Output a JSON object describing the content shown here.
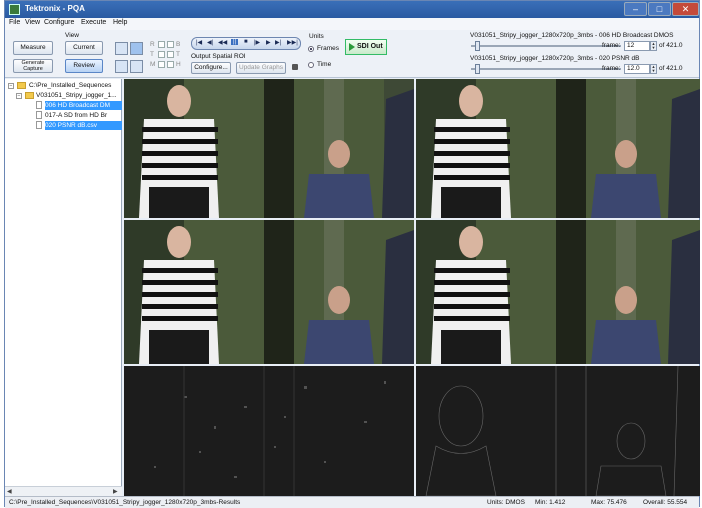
{
  "window": {
    "title": "Tektronix - PQA",
    "controls": {
      "minimize": "–",
      "maximize": "□",
      "close": "✕"
    }
  },
  "menu": [
    "File",
    "View",
    "Configure",
    "Execute",
    "Help"
  ],
  "toolbar": {
    "view_label": "View",
    "measure_label": "Measure",
    "current_label": "Current",
    "generate_capture_label": "Generate Capture",
    "review_label": "Review",
    "rgb_labels": [
      "R",
      "G",
      "B"
    ],
    "tt_labels": [
      "T",
      "T"
    ],
    "mh_labels": [
      "M",
      "H"
    ],
    "output_roi_label": "Output Spatial ROI",
    "configure_label": "Configure...",
    "update_graphs_label": "Update Graphs",
    "units_label": "Units",
    "frames_label": "Frames",
    "time_label": "Time",
    "units_selected": "Frames",
    "sdi_label": "SDI Out",
    "transport_glyphs": [
      "|◀",
      "◀|",
      "◀◀",
      "||",
      "■",
      "|▶",
      "▶",
      "▶|",
      "▶▶|"
    ]
  },
  "sequences": [
    {
      "name": "V031051_Stripy_jogger_1280x720p_3mbs - 006 HD Broadcast DMOS",
      "frame_label": "frame:",
      "frame_value": "12",
      "of_label": "of 421.0",
      "slider_fraction": 0.03
    },
    {
      "name": "V031051_Stripy_jogger_1280x720p_3mbs - 020 PSNR dB",
      "frame_label": "frame:",
      "frame_value": "12.0",
      "of_label": "of 421.0",
      "slider_fraction": 0.03
    }
  ],
  "tree": {
    "root": "C:\\Pre_Installed_Sequences",
    "child": "V031051_Stripy_jogger_1...",
    "items": [
      {
        "label": "006 HD Broadcast DM",
        "selected": true
      },
      {
        "label": "017-A SD from HD Br",
        "selected": false
      },
      {
        "label": "020 PSNR dB.csv",
        "selected": true
      }
    ],
    "expand_minus": "−",
    "scroll_left": "◀",
    "scroll_right": "▶"
  },
  "status": {
    "path": "C:\\Pre_Installed_Sequences\\V031051_Stripy_jogger_1280x720p_3mbs-Results",
    "units": "Units: DMOS",
    "min": "Min: 1.412",
    "max": "Max: 75.476",
    "overall": "Overall: 55.554"
  },
  "colors": {
    "accent": "#3399ff",
    "titlebar": "#2a5aa2",
    "sdi_play": "#2a9a3a"
  }
}
